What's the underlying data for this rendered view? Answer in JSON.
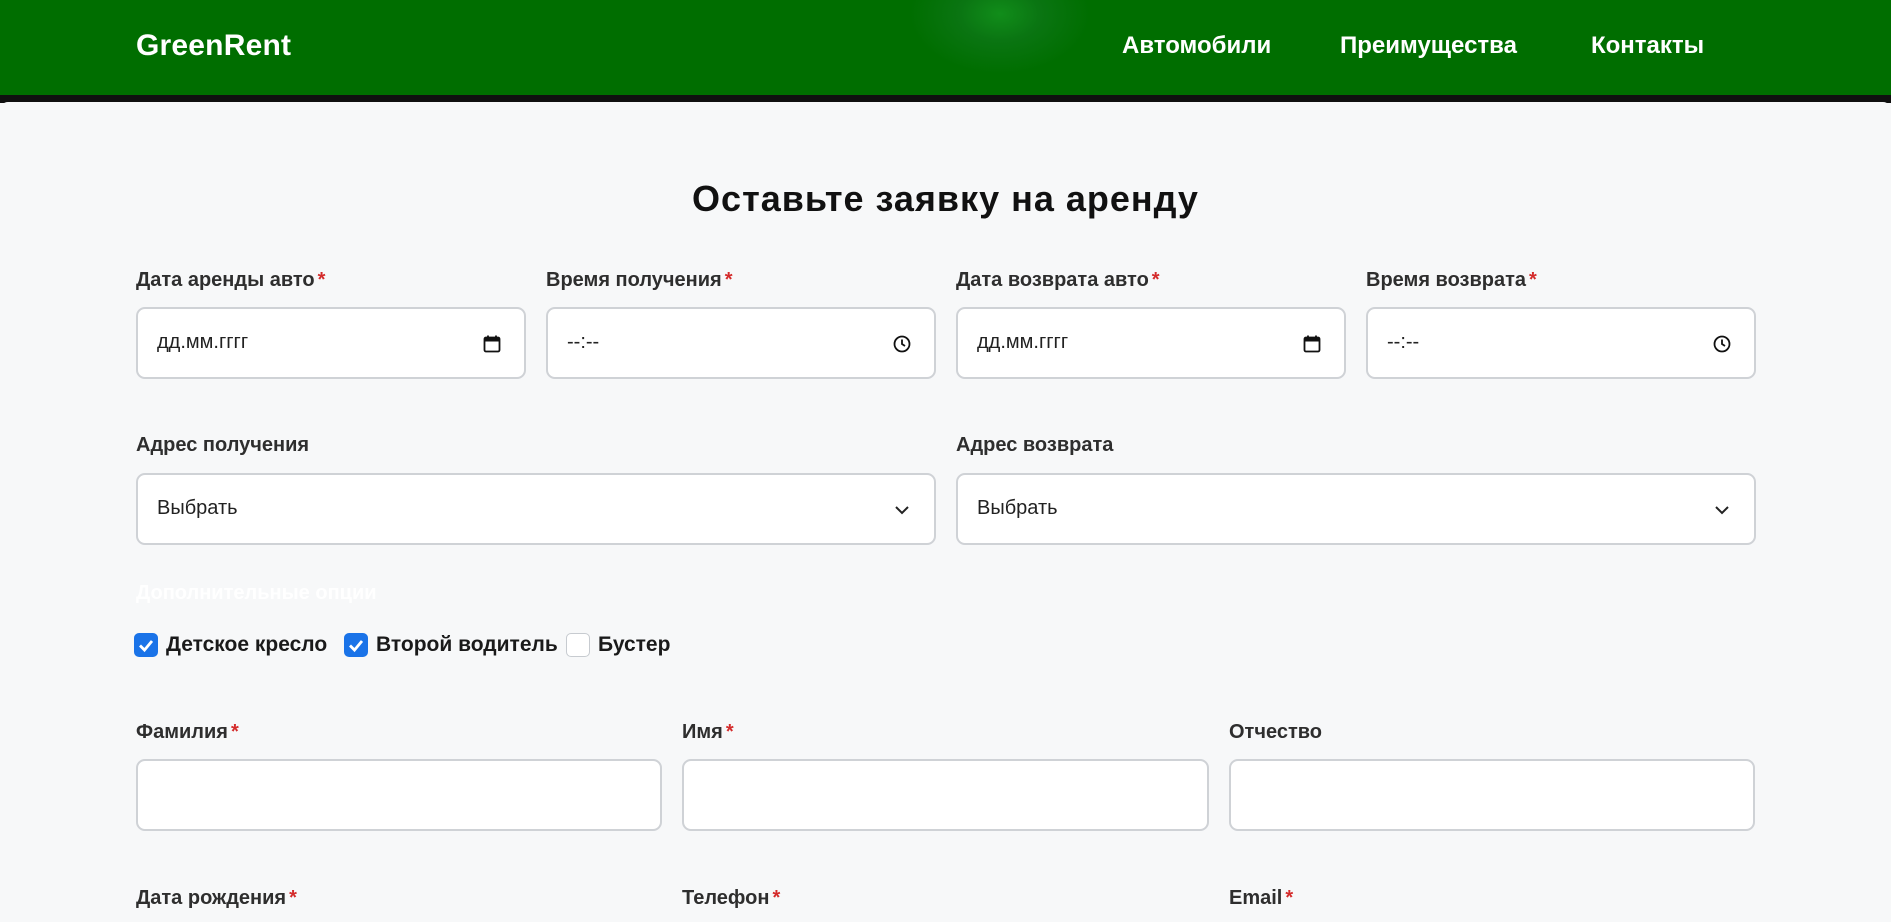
{
  "header": {
    "logo": "GreenRent",
    "nav": [
      "Автомобили",
      "Преимущества",
      "Контакты"
    ]
  },
  "form": {
    "title": "Оставьте заявку на аренду",
    "required_mark": "*",
    "rent_date": {
      "label": "Дата аренды авто",
      "placeholder": "дд.мм.гггг",
      "required": true
    },
    "pickup_time": {
      "label": "Время получения",
      "placeholder": "--:--",
      "required": true
    },
    "return_date": {
      "label": "Дата возврата авто",
      "placeholder": "дд.мм.гггг",
      "required": true
    },
    "return_time": {
      "label": "Время возврата",
      "placeholder": "--:--",
      "required": true
    },
    "pickup_address": {
      "label": "Адрес получения",
      "selected": "Выбрать"
    },
    "return_address": {
      "label": "Адрес возврата",
      "selected": "Выбрать"
    },
    "options": {
      "heading": "Дополнительные опции",
      "items": [
        {
          "label": "Детское кресло",
          "checked": true
        },
        {
          "label": "Второй водитель",
          "checked": true
        },
        {
          "label": "Бустер",
          "checked": false
        }
      ]
    },
    "last_name": {
      "label": "Фамилия",
      "value": "",
      "required": true
    },
    "first_name": {
      "label": "Имя",
      "value": "",
      "required": true
    },
    "middle_name": {
      "label": "Отчество",
      "value": "",
      "required": false
    },
    "birth_date": {
      "label": "Дата рождения",
      "required": true
    },
    "phone": {
      "label": "Телефон",
      "required": true
    },
    "email": {
      "label": "Email",
      "required": true
    }
  },
  "colors": {
    "header_green": "#006e00",
    "required_red": "#d42b2b",
    "checkbox_blue": "#1a73e8"
  }
}
